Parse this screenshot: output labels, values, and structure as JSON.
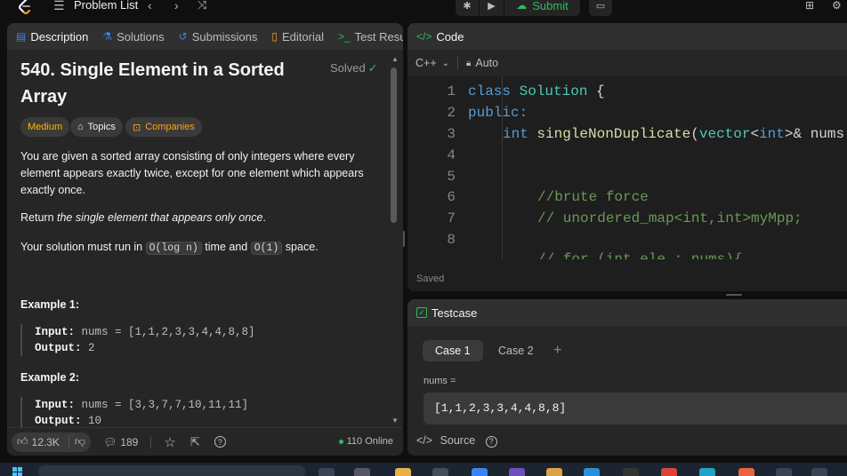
{
  "nav": {
    "problem_list": "Problem List",
    "submit": "Submit"
  },
  "description_tabs": [
    {
      "label": "Description"
    },
    {
      "label": "Solutions"
    },
    {
      "label": "Submissions"
    },
    {
      "label": "Editorial"
    },
    {
      "label": "Test Resu"
    }
  ],
  "problem": {
    "title": "540. Single Element in a Sorted Array",
    "status": "Solved",
    "difficulty": "Medium",
    "topics": "Topics",
    "companies": "Companies",
    "para1": "You are given a sorted array consisting of only integers where every element appears exactly twice, except for one element which appears exactly once.",
    "para2_prefix": "Return ",
    "para2_italic": "the single element that appears only once",
    "para2_suffix": ".",
    "para3_a": "Your solution must run in ",
    "para3_code1": "O(log n)",
    "para3_b": " time and ",
    "para3_code2": "O(1)",
    "para3_c": " space.",
    "examples": [
      {
        "title": "Example 1:",
        "input_label": "Input:",
        "input": "nums = [1,1,2,3,3,4,4,8,8]",
        "output_label": "Output:",
        "output": "2"
      },
      {
        "title": "Example 2:",
        "input_label": "Input:",
        "input": "nums = [3,3,7,7,10,11,11]",
        "output_label": "Output:",
        "output": "10"
      }
    ]
  },
  "footer": {
    "likes": "12.3K",
    "comments": "189",
    "online": "110 Online"
  },
  "code": {
    "title": "Code",
    "language": "C++",
    "mode": "Auto",
    "saved": "Saved",
    "line_numbers": [
      "1",
      "2",
      "3",
      "4",
      "5",
      "6",
      "7",
      "8"
    ],
    "lines": {
      "l1_kw": "class",
      "l1_ty": "Solution",
      "l1_rest": " {",
      "l2_kw": "public:",
      "l3_kw": "int",
      "l3_fn": "singleNonDuplicate",
      "l3_a": "(",
      "l3_ty": "vector",
      "l3_b": "<",
      "l3_kw2": "int",
      "l3_c": ">& nums",
      "l6": "//brute force",
      "l7": "// unordered_map<int,int>myMpp;",
      "l9": "// for (int ele : nums){"
    }
  },
  "testcase": {
    "title": "Testcase",
    "case1": "Case 1",
    "case2": "Case 2",
    "nums_label": "nums =",
    "nums_value": "[1,1,2,3,3,4,4,8,8]",
    "source": "Source"
  }
}
